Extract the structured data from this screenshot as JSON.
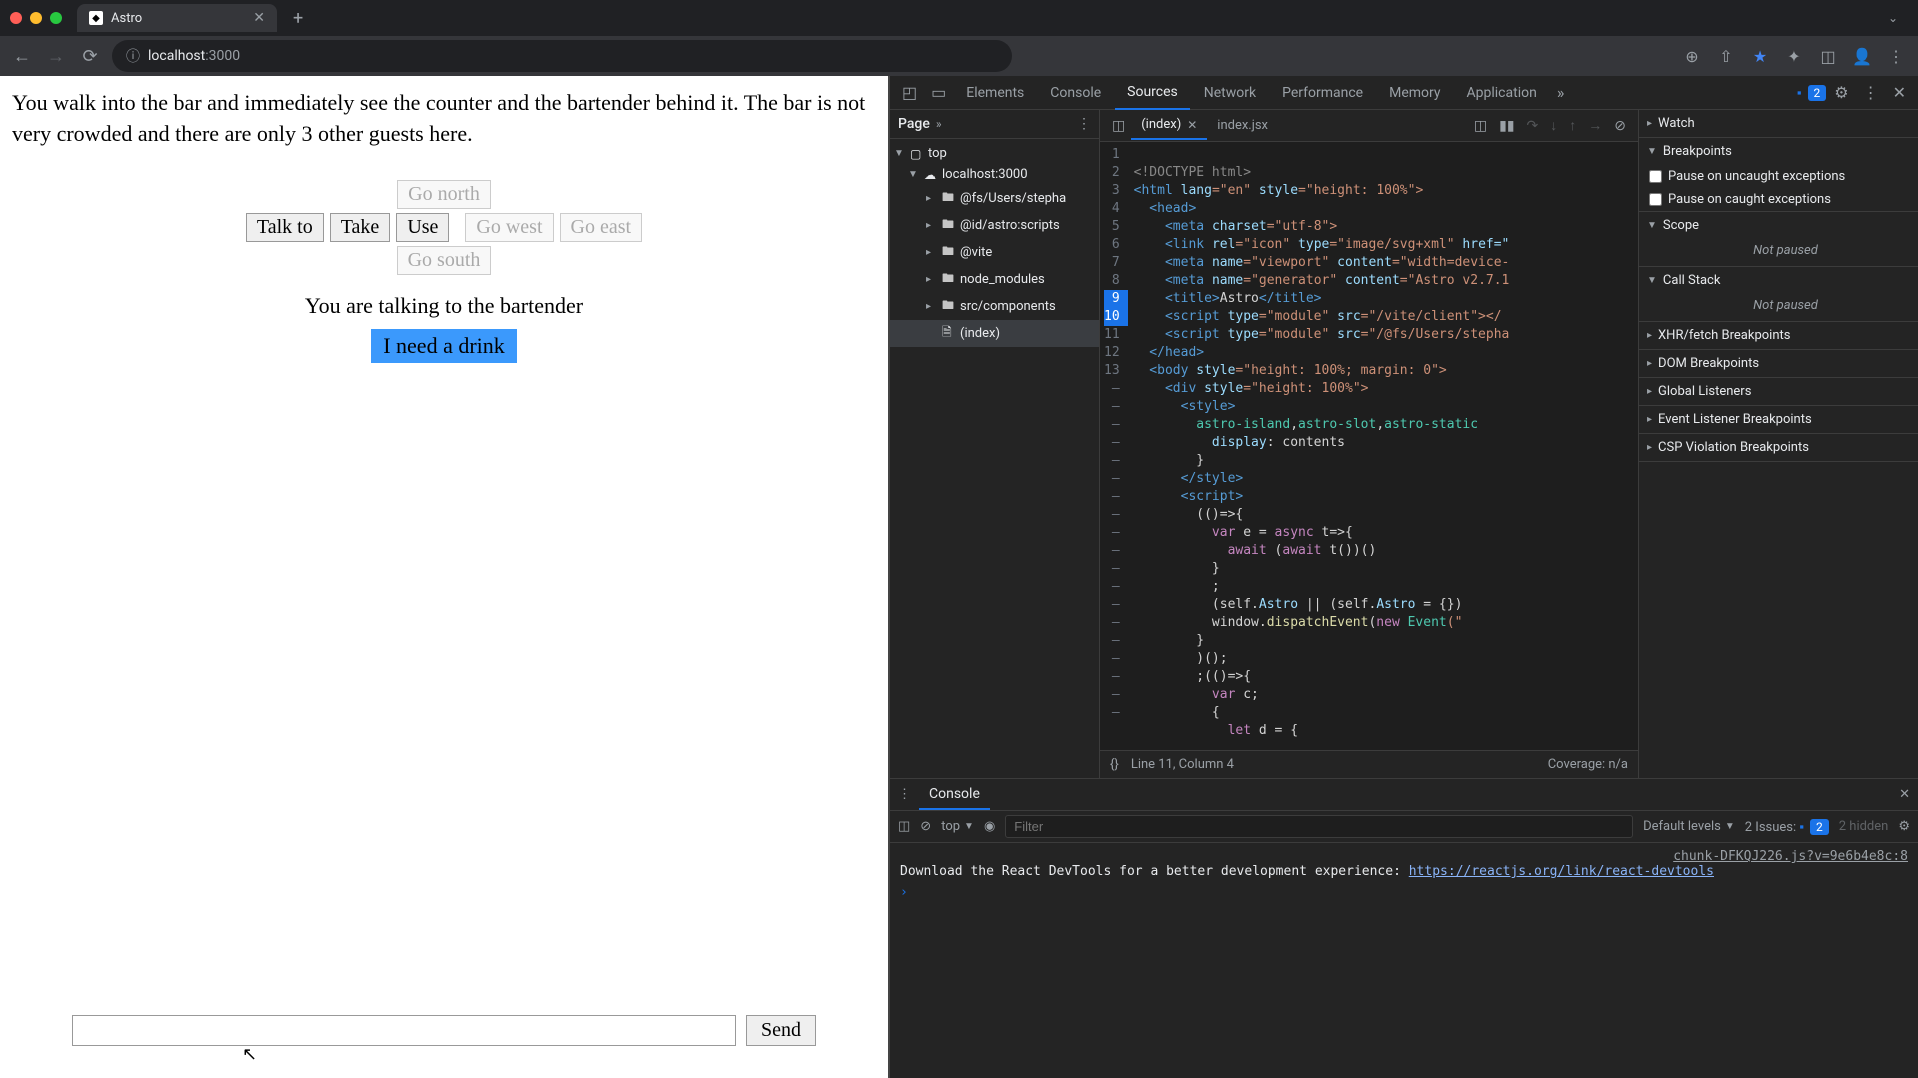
{
  "browser": {
    "tab_title": "Astro",
    "url_host": "localhost",
    "url_port": ":3000"
  },
  "game": {
    "room_text": "You walk into the bar and immediately see the counter and the bartender behind it. The bar is not very crowded and there are only 3 other guests here.",
    "actions": {
      "talk": "Talk to",
      "take": "Take",
      "use": "Use"
    },
    "nav": {
      "north": "Go north",
      "west": "Go west",
      "east": "Go east",
      "south": "Go south"
    },
    "talking": "You are talking to the bartender",
    "dialog_option": "I need a drink",
    "send": "Send"
  },
  "devtools": {
    "tabs": {
      "elements": "Elements",
      "console": "Console",
      "sources": "Sources",
      "network": "Network",
      "performance": "Performance",
      "memory": "Memory",
      "application": "Application"
    },
    "issues_count": "2",
    "page_panel": {
      "label": "Page",
      "tree": {
        "top": "top",
        "host": "localhost:3000",
        "folders": [
          "@fs/Users/stepha",
          "@id/astro:scripts",
          "@vite",
          "node_modules",
          "src/components"
        ],
        "file": "(index)"
      }
    },
    "editor": {
      "tab_active": "(index)",
      "tab_other": "index.jsx",
      "status_left": "{}",
      "status_line": "Line 11, Column 4",
      "status_cov": "Coverage: n/a"
    },
    "debug": {
      "watch": "Watch",
      "breakpoints": "Breakpoints",
      "bp_uncaught": "Pause on uncaught exceptions",
      "bp_caught": "Pause on caught exceptions",
      "scope": "Scope",
      "not_paused": "Not paused",
      "callstack": "Call Stack",
      "xhr": "XHR/fetch Breakpoints",
      "dom": "DOM Breakpoints",
      "global": "Global Listeners",
      "event": "Event Listener Breakpoints",
      "csp": "CSP Violation Breakpoints"
    },
    "console": {
      "title": "Console",
      "ctx": "top",
      "filter_ph": "Filter",
      "levels": "Default levels",
      "issues_label": "2 Issues:",
      "issues_badge": "2",
      "hidden": "2 hidden",
      "src": "chunk-DFKQJ226.js?v=9e6b4e8c:8",
      "msg": "Download the React DevTools for a better development experience: ",
      "link": "https://reactjs.org/link/react-devtools"
    }
  },
  "code": {
    "l1": "<!DOCTYPE html>",
    "l2_a": "<html ",
    "l2_b": "lang",
    "l2_c": "=\"en\" ",
    "l2_d": "style",
    "l2_e": "=\"height: 100%\">",
    "l3": "  <head>",
    "l4_a": "    <meta ",
    "l4_b": "charset",
    "l4_c": "=\"utf-8\">",
    "l5_a": "    <link ",
    "l5_b": "rel",
    "l5_c": "=\"icon\" ",
    "l5_d": "type",
    "l5_e": "=\"image/svg+xml\" ",
    "l5_f": "href=\"",
    "l6_a": "    <meta ",
    "l6_b": "name",
    "l6_c": "=\"viewport\" ",
    "l6_d": "content",
    "l6_e": "=\"width=device-",
    "l7_a": "    <meta ",
    "l7_b": "name",
    "l7_c": "=\"generator\" ",
    "l7_d": "content",
    "l7_e": "=\"Astro v2.7.1",
    "l8_a": "    <title>",
    "l8_b": "Astro",
    "l8_c": "</title>",
    "l9_a": "    <script ",
    "l9_b": "type",
    "l9_c": "=\"module\" ",
    "l9_d": "src",
    "l9_e": "=\"/vite/client\"></",
    "l10_a": "    <script ",
    "l10_b": "type",
    "l10_c": "=\"module\" ",
    "l10_d": "src",
    "l10_e": "=\"/@fs/Users/stepha",
    "l11": "  </head>",
    "l12_a": "  <body ",
    "l12_b": "style",
    "l12_c": "=\"height: 100%; margin: 0\">",
    "l13_a": "    <div ",
    "l13_b": "style",
    "l13_c": "=\"height: 100%\">",
    "l14": "      <style>",
    "l15_a": "        astro-island",
    "l15_b": ",",
    "l15_c": "astro-slot",
    "l15_d": ",",
    "l15_e": "astro-static",
    "l16_a": "          display",
    "l16_b": ": contents",
    "l17": "        }",
    "l18": "      </style>",
    "l19": "      <script>",
    "l20": "        (()=>{",
    "l21_a": "          var ",
    "l21_b": "e = ",
    "l21_c": "async ",
    "l21_d": "t=>{",
    "l22_a": "            await ",
    "l22_b": "(",
    "l22_c": "await ",
    "l22_d": "t())()",
    "l23": "          }",
    "l24": "          ;",
    "l25_a": "          (self.",
    "l25_b": "Astro ",
    "l25_c": "|| (self.",
    "l25_d": "Astro ",
    "l25_e": "= {})",
    "l26_a": "          window.",
    "l26_b": "dispatchEvent",
    "l26_c": "(",
    "l26_d": "new ",
    "l26_e": "Event",
    "l26_f": "(\"",
    "l27": "        }",
    "l28": "        )();",
    "l29": "        ;(()=>{",
    "l30_a": "          var ",
    "l30_b": "c;",
    "l31": "          {",
    "l32_a": "            let ",
    "l32_b": "d = {"
  }
}
